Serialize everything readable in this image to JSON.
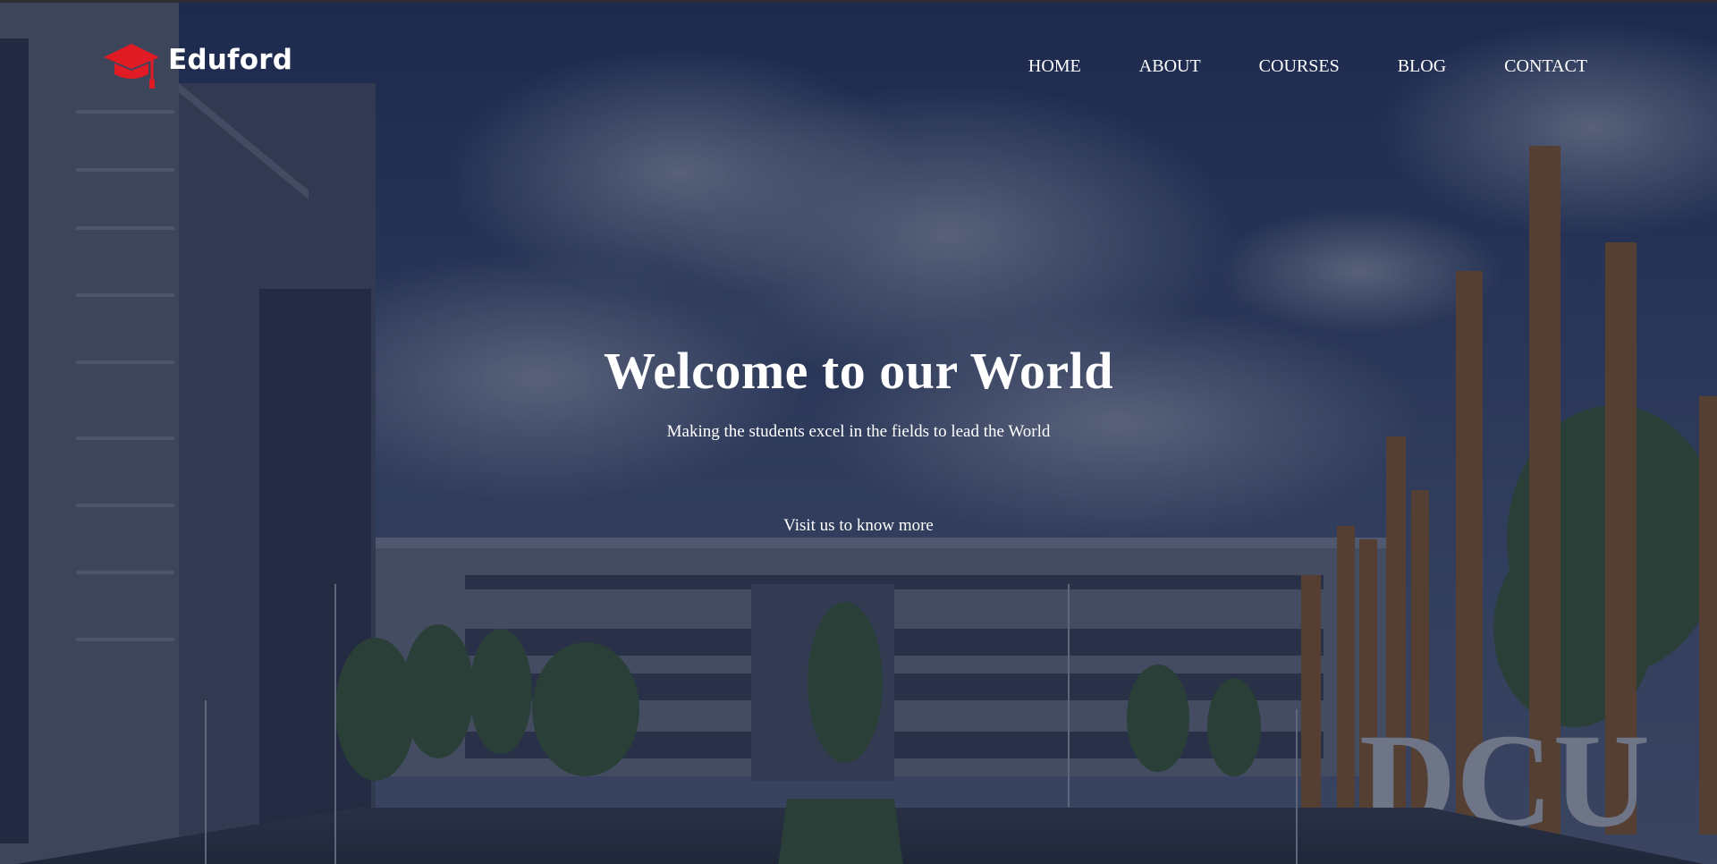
{
  "brand": {
    "name": "Eduford",
    "logo_icon": "graduation-cap-icon",
    "logo_color": "#e01b24"
  },
  "nav": {
    "items": [
      {
        "label": "HOME"
      },
      {
        "label": "ABOUT"
      },
      {
        "label": "COURSES"
      },
      {
        "label": "BLOG"
      },
      {
        "label": "CONTACT"
      }
    ]
  },
  "hero": {
    "title": "Welcome to our World",
    "subtitle": "Making the students excel in the fields to lead the World",
    "cta_label": "Visit us to know more",
    "background_sign": "DCU"
  },
  "colors": {
    "overlay": "#141e3c",
    "text": "#ffffff",
    "accent": "#e01b24"
  }
}
